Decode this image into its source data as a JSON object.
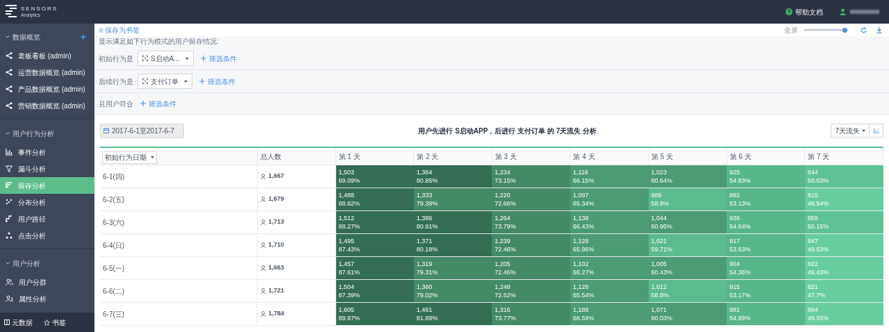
{
  "brand": {
    "name": "SENSORS",
    "sub": "Analytics"
  },
  "header": {
    "help": "帮助文档"
  },
  "sidebar": {
    "sections": [
      {
        "title": "数据概览",
        "expanded": true,
        "add": "+",
        "items": [
          {
            "label": "老板看板 (admin)",
            "kind": "share",
            "selected": false
          },
          {
            "label": "运营数据概览 (admin)",
            "kind": "share",
            "selected": false
          },
          {
            "label": "产品数据概览 (admin)",
            "kind": "share",
            "selected": false
          },
          {
            "label": "营销数据概览 (admin)",
            "kind": "share",
            "selected": false
          }
        ]
      },
      {
        "title": "用户行为分析",
        "expanded": true,
        "items": [
          {
            "label": "事件分析",
            "kind": "bar",
            "selected": false
          },
          {
            "label": "漏斗分析",
            "kind": "funnel",
            "selected": false
          },
          {
            "label": "留存分析",
            "kind": "retention",
            "selected": true
          },
          {
            "label": "分布分析",
            "kind": "scatter",
            "selected": false
          },
          {
            "label": "用户路径",
            "kind": "path",
            "selected": false
          },
          {
            "label": "点击分析",
            "kind": "click",
            "selected": false
          }
        ]
      },
      {
        "title": "用户分析",
        "expanded": true,
        "items": [
          {
            "label": "用户分群",
            "kind": "users",
            "selected": false
          },
          {
            "label": "属性分析",
            "kind": "attributes",
            "selected": false
          }
        ]
      }
    ],
    "footer": [
      "元数据",
      "书签"
    ]
  },
  "toolbar": {
    "bookmark": "保存为书签",
    "fullscreen": "全屏",
    "zoom": {
      "level": 1
    }
  },
  "filters": {
    "intro": "显示满足如下行为模式的用户留存情况:",
    "rows": [
      {
        "label": "初始行为是",
        "event": "S启动A...",
        "add": "筛选条件"
      },
      {
        "label": "后续行为是",
        "event": "支付订单",
        "add": "筛选条件"
      },
      {
        "label": "且用户符合",
        "add": "筛选条件"
      }
    ]
  },
  "report": {
    "date_range": "2017-6-1至2017-6-7",
    "title": "用户先进行 S启动APP，后进行 支付订单 的 7天流失 分析",
    "mode": "7天流失"
  },
  "table": {
    "columns": [
      "初始行为日期",
      "总人数",
      "第 1 天",
      "第 2 天",
      "第 3 天",
      "第 4 天",
      "第 5 天",
      "第 6 天",
      "第 7 天"
    ],
    "rows": [
      {
        "cells": [
          "6-1(四)",
          "1,667",
          {
            "count": "1,503",
            "percent": "89.09%",
            "color": "#336e54"
          },
          {
            "count": "1,364",
            "percent": "80.85%",
            "color": "#336e54"
          },
          {
            "count": "1,234",
            "percent": "73.15%",
            "color": "#438a67"
          },
          {
            "count": "1,116",
            "percent": "66.15%",
            "color": "#4b9b74"
          },
          {
            "count": "1,023",
            "percent": "60.64%",
            "color": "#4b9b74"
          },
          {
            "count": "925",
            "percent": "54.83%",
            "color": "#57b68a"
          },
          {
            "count": "844",
            "percent": "50.03%",
            "color": "#5fc196"
          }
        ]
      },
      {
        "cells": [
          "6-2(五)",
          "1,679",
          {
            "count": "1,488",
            "percent": "88.62%",
            "color": "#336e54"
          },
          {
            "count": "1,333",
            "percent": "79.39%",
            "color": "#438a67"
          },
          {
            "count": "1,220",
            "percent": "72.66%",
            "color": "#438a67"
          },
          {
            "count": "1,097",
            "percent": "65.34%",
            "color": "#4b9b74"
          },
          {
            "count": "989",
            "percent": "58.9%",
            "color": "#5bbb8f"
          },
          {
            "count": "892",
            "percent": "53.13%",
            "color": "#57b68a"
          },
          {
            "count": "815",
            "percent": "48.54%",
            "color": "#67cd9f"
          }
        ]
      },
      {
        "cells": [
          "6-3(六)",
          "1,713",
          {
            "count": "1,512",
            "percent": "88.27%",
            "color": "#336e54"
          },
          {
            "count": "1,386",
            "percent": "80.91%",
            "color": "#336e54"
          },
          {
            "count": "1,264",
            "percent": "73.79%",
            "color": "#438a67"
          },
          {
            "count": "1,138",
            "percent": "66.43%",
            "color": "#4b9b74"
          },
          {
            "count": "1,044",
            "percent": "60.95%",
            "color": "#4b9b74"
          },
          {
            "count": "936",
            "percent": "54.64%",
            "color": "#57b68a"
          },
          {
            "count": "859",
            "percent": "50.15%",
            "color": "#5fc196"
          }
        ]
      },
      {
        "cells": [
          "6-4(日)",
          "1,710",
          {
            "count": "1,495",
            "percent": "87.43%",
            "color": "#336e54"
          },
          {
            "count": "1,371",
            "percent": "80.18%",
            "color": "#336e54"
          },
          {
            "count": "1,239",
            "percent": "72.46%",
            "color": "#438a67"
          },
          {
            "count": "1,128",
            "percent": "65.96%",
            "color": "#4b9b74"
          },
          {
            "count": "1,021",
            "percent": "59.71%",
            "color": "#5bbb8f"
          },
          {
            "count": "917",
            "percent": "53.63%",
            "color": "#57b68a"
          },
          {
            "count": "847",
            "percent": "49.53%",
            "color": "#67cd9f"
          }
        ]
      },
      {
        "cells": [
          "6-5(一)",
          "1,663",
          {
            "count": "1,457",
            "percent": "87.61%",
            "color": "#336e54"
          },
          {
            "count": "1,319",
            "percent": "79.31%",
            "color": "#438a67"
          },
          {
            "count": "1,205",
            "percent": "72.46%",
            "color": "#438a67"
          },
          {
            "count": "1,102",
            "percent": "66.27%",
            "color": "#4b9b74"
          },
          {
            "count": "1,005",
            "percent": "60.43%",
            "color": "#4b9b74"
          },
          {
            "count": "904",
            "percent": "54.36%",
            "color": "#57b68a"
          },
          {
            "count": "822",
            "percent": "49.43%",
            "color": "#67cd9f"
          }
        ]
      },
      {
        "cells": [
          "6-6(二)",
          "1,721",
          {
            "count": "1,504",
            "percent": "87.39%",
            "color": "#336e54"
          },
          {
            "count": "1,360",
            "percent": "79.02%",
            "color": "#438a67"
          },
          {
            "count": "1,248",
            "percent": "72.52%",
            "color": "#438a67"
          },
          {
            "count": "1,128",
            "percent": "65.54%",
            "color": "#4b9b74"
          },
          {
            "count": "1,012",
            "percent": "58.8%",
            "color": "#5bbb8f"
          },
          {
            "count": "915",
            "percent": "53.17%",
            "color": "#57b68a"
          },
          {
            "count": "821",
            "percent": "47.7%",
            "color": "#67cd9f"
          }
        ]
      },
      {
        "cells": [
          "6-7(三)",
          "1,784",
          {
            "count": "1,605",
            "percent": "89.97%",
            "color": "#336e54"
          },
          {
            "count": "1,461",
            "percent": "81.89%",
            "color": "#336e54"
          },
          {
            "count": "1,316",
            "percent": "73.77%",
            "color": "#438a67"
          },
          {
            "count": "1,188",
            "percent": "66.59%",
            "color": "#4b9b74"
          },
          {
            "count": "1,071",
            "percent": "60.03%",
            "color": "#4b9b74"
          },
          {
            "count": "981",
            "percent": "54.99%",
            "color": "#57b68a"
          },
          {
            "count": "884",
            "percent": "49.55%",
            "color": "#67cd9f"
          }
        ]
      }
    ]
  }
}
